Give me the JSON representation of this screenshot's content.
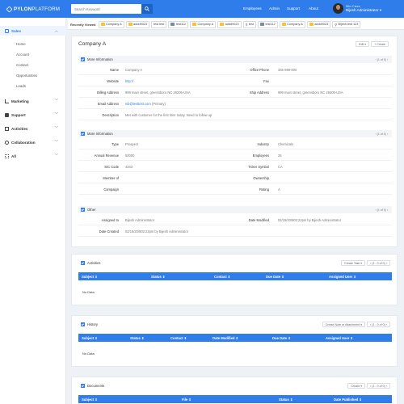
{
  "brand": {
    "bold": "PYLON",
    "light": "PLATFORM"
  },
  "search": {
    "placeholder": "Search Keyword"
  },
  "nav": [
    "Employees",
    "Admin",
    "Support",
    "About"
  ],
  "user": {
    "label": "Who Cares",
    "name": "Bijesh Administrator ▾"
  },
  "recent": {
    "label": "Recently Viewed",
    "items": [
      {
        "text": "Company A",
        "icon": "folder"
      },
      {
        "text": "addd9023",
        "icon": "folder"
      },
      {
        "text": "test test",
        "icon": "none"
      },
      {
        "text": "test112",
        "icon": "monitor"
      },
      {
        "text": "Company A",
        "icon": "folder"
      },
      {
        "text": "addd9023",
        "icon": "folder"
      },
      {
        "text": "test",
        "icon": "search"
      },
      {
        "text": "test112",
        "icon": "monitor"
      },
      {
        "text": "Company A",
        "icon": "folder"
      },
      {
        "text": "addd9023",
        "icon": "folder"
      },
      {
        "text": "Bijesh test 123",
        "icon": "search"
      }
    ]
  },
  "sidebar": {
    "sales": "Sales",
    "sales_items": [
      "Home",
      "Account",
      "Contact",
      "Opportunities",
      "Leads"
    ],
    "groups": [
      "Marketing",
      "Support",
      "Activities",
      "Collaboration",
      "All"
    ]
  },
  "record": {
    "title": "Company A",
    "edit_label": "Edit ▾",
    "create_label": "+ Create",
    "pager": "‹  (1 of 0)  ›"
  },
  "section1": {
    "title": "More Information",
    "rows": [
      {
        "l1": "Name",
        "v1": "Company A",
        "l2": "Office Phone",
        "v2": "335-999-000"
      },
      {
        "l1": "Website",
        "v1": "http://",
        "l2": "Fax",
        "v2": ""
      },
      {
        "l1": "Billing Address",
        "v1": "999 main street, greensboro NC 28205-USA",
        "l2": "Ship Address",
        "v2": "999 main street, greensboro NC 28205-USA"
      },
      {
        "l1": "Email Address",
        "v1": "nib@testtest.com",
        "v1b": "(Primary)",
        "l2": "",
        "v2": ""
      },
      {
        "l1": "Description",
        "v1": "Met with customer for the first time today. Need to follow up",
        "l2": "",
        "v2": ""
      }
    ]
  },
  "section2": {
    "title": "More Information",
    "rows": [
      {
        "l1": "Type",
        "v1": "Prospect",
        "l2": "Industry",
        "v2": "Chemicals"
      },
      {
        "l1": "Annual Revenue",
        "v1": "50000",
        "l2": "Employees",
        "v2": "25"
      },
      {
        "l1": "SIC Code",
        "v1": "4343",
        "l2": "Ticker Symbol",
        "v2": "CA"
      },
      {
        "l1": "Member of",
        "v1": "",
        "l2": "Ownership",
        "v2": ""
      },
      {
        "l1": "Campaign",
        "v1": "",
        "l2": "Rating",
        "v2": "A"
      }
    ]
  },
  "section3": {
    "title": "Other",
    "rows": [
      {
        "l1": "Assigned to",
        "v1": "Bijesh Administrator",
        "l2": "Date Modified",
        "v2": "02/15/20/802:22pm by Bijesh Administrator"
      },
      {
        "l1": "Date Created",
        "v1": "02/15/20/802:22pm by Bijesh Administrator",
        "l2": "",
        "v2": ""
      }
    ]
  },
  "activities": {
    "title": "Activities",
    "action": "Create Task ▾",
    "pager": "‹  (1 - 0 of 0)  ›",
    "columns": [
      "Subject ⇕",
      "Status ⇕",
      "Contact ⇕",
      "Due Date ⇕",
      "Assigned User ⇕"
    ],
    "empty": "No Data"
  },
  "history": {
    "title": "History",
    "action": "Create Note or Attachment ▾",
    "pager": "‹  (1 - 0 of 0)  ›",
    "columns": [
      "Subject ⇕",
      "Status ⇕",
      "Contact ⇕",
      "Date Modified ⇕",
      "Due Date ⇕",
      "Assigned User ⇕"
    ],
    "empty": "No Data"
  },
  "documents": {
    "title": "Documents",
    "action": "Create ▾",
    "pager": "‹  (1 - 0 of 0)  ›",
    "columns": [
      "Subject ⇕",
      "File ⇕",
      "Status ⇕",
      "Date Published ⇕"
    ]
  },
  "colors": {
    "primary": "#2f7dea",
    "folder": "#f5c33a"
  }
}
